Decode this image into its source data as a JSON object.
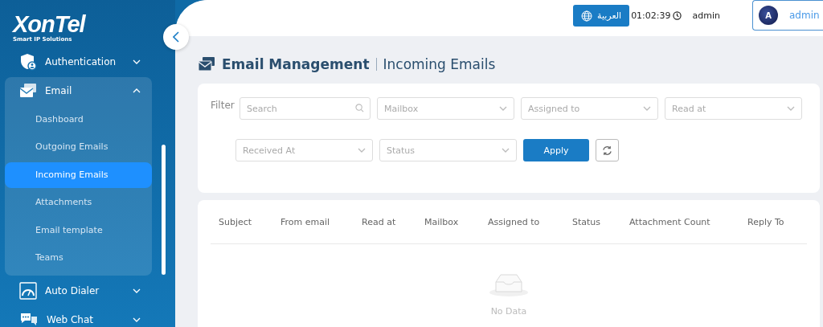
{
  "logo": {
    "name": "XonTel",
    "tagline": "Smart IP Solutions"
  },
  "sidebar": {
    "items": [
      {
        "label": "Authentication",
        "expanded": false
      },
      {
        "label": "Email",
        "expanded": true,
        "children": [
          {
            "label": "Dashboard",
            "selected": false
          },
          {
            "label": "Outgoing Emails",
            "selected": false
          },
          {
            "label": "Incoming Emails",
            "selected": true
          },
          {
            "label": "Attachments",
            "selected": false
          },
          {
            "label": "Email template",
            "selected": false
          },
          {
            "label": "Teams",
            "selected": false
          }
        ]
      },
      {
        "label": "Auto Dialer",
        "expanded": false
      },
      {
        "label": "Web Chat",
        "expanded": false
      }
    ]
  },
  "topbar": {
    "language_button": "العربية",
    "time": "01:02:39",
    "username": "admin",
    "user": {
      "initial": "A",
      "name": "admin"
    }
  },
  "page": {
    "title": "Email Management",
    "subtitle": "Incoming Emails"
  },
  "filter": {
    "label": "Filter",
    "search": {
      "placeholder": "Search"
    },
    "row_1": [
      {
        "placeholder": "Mailbox"
      },
      {
        "placeholder": "Assigned to"
      },
      {
        "placeholder": "Read at"
      }
    ],
    "row_2": [
      {
        "placeholder": "Received At"
      },
      {
        "placeholder": "Status"
      }
    ],
    "apply_button": "Apply"
  },
  "table": {
    "columns": [
      "Subject",
      "From email",
      "Read at",
      "Mailbox",
      "Assigned to",
      "Status",
      "Attachment Count",
      "Reply To"
    ],
    "empty_text": "No Data"
  }
}
